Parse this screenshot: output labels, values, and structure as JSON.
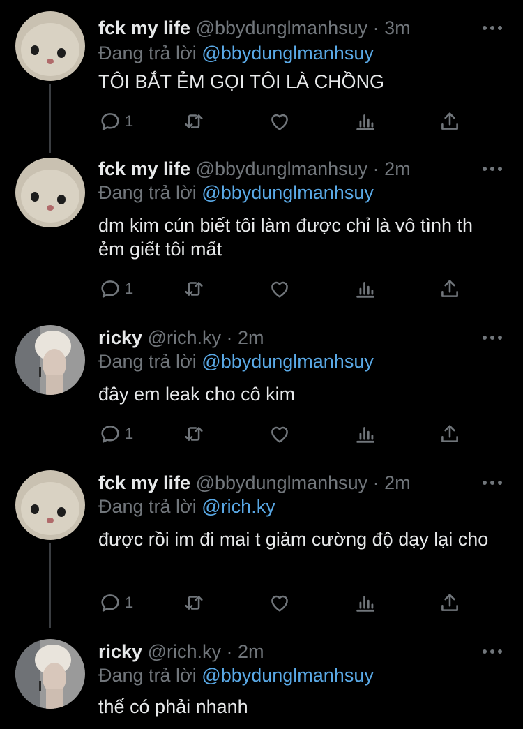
{
  "tweets": [
    {
      "name": "fck my life",
      "handle": "@bbydunglmanhsuy",
      "sep": "·",
      "time": "3m",
      "replying_label": "Đang trả lời",
      "replying_to": "@bbydunglmanhsuy",
      "text": "TÔI BẮT ẺM GỌI TÔI LÀ CHỒNG",
      "reply_count": "1",
      "avatar": "cat"
    },
    {
      "name": "fck my life",
      "handle": "@bbydunglmanhsuy",
      "sep": "·",
      "time": "2m",
      "replying_label": "Đang trả lời",
      "replying_to": "@bbydunglmanhsuy",
      "text": "dm kim cún biết tôi làm được chỉ là vô tình th ẻm giết tôi mất",
      "reply_count": "1",
      "avatar": "cat"
    },
    {
      "name": "ricky",
      "handle": "@rich.ky",
      "sep": "·",
      "time": "2m",
      "replying_label": "Đang trả lời",
      "replying_to": "@bbydunglmanhsuy",
      "text": "đây em leak cho cô kim",
      "reply_count": "1",
      "avatar": "person"
    },
    {
      "name": "fck my life",
      "handle": "@bbydunglmanhsuy",
      "sep": "·",
      "time": "2m",
      "replying_label": "Đang trả lời",
      "replying_to": "@rich.ky",
      "text": "được rồi im đi mai t giảm cường độ dạy lại cho",
      "reply_count": "1",
      "avatar": "cat"
    },
    {
      "name": "ricky",
      "handle": "@rich.ky",
      "sep": "·",
      "time": "2m",
      "replying_label": "Đang trả lời",
      "replying_to": "@bbydunglmanhsuy",
      "text": "thế có phải nhanh",
      "reply_count": "",
      "avatar": "person"
    }
  ],
  "icons": [
    "reply-icon",
    "retweet-icon",
    "like-icon",
    "analytics-icon",
    "share-icon",
    "more-icon"
  ],
  "colors": {
    "background": "#000000",
    "text": "#e7e9ea",
    "muted": "#71767b",
    "link": "#5aa9e6"
  }
}
